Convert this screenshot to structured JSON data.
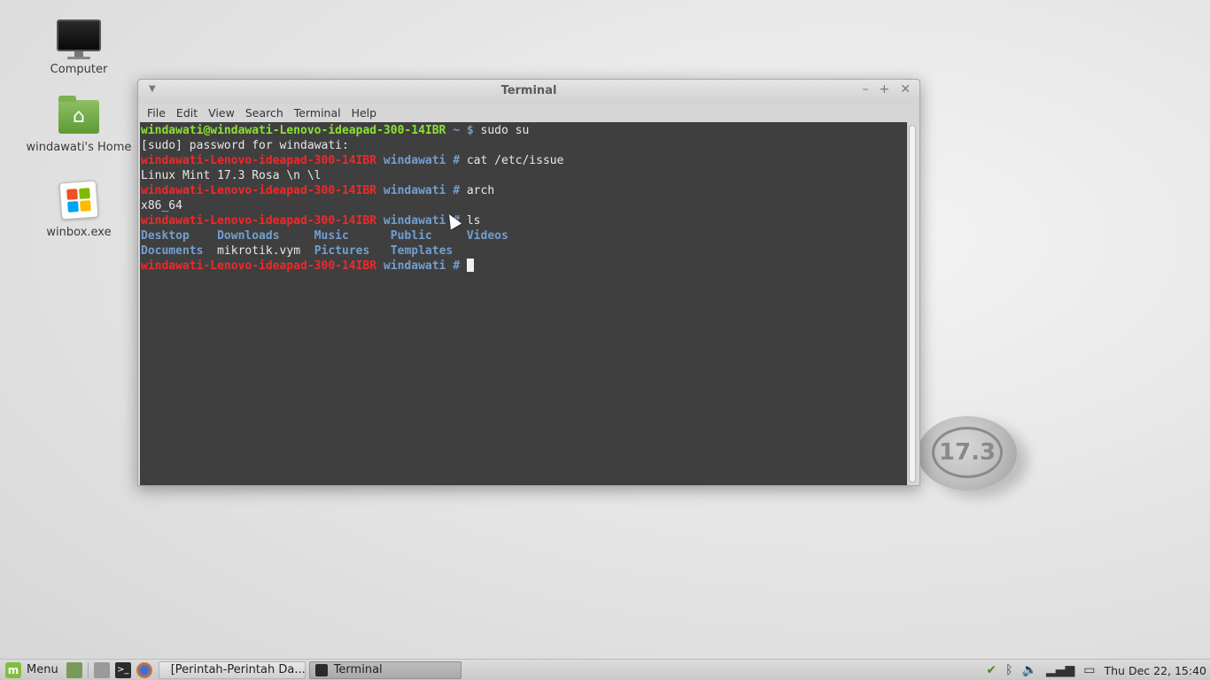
{
  "desktop": {
    "icons": [
      {
        "label": "Computer",
        "icon": "computer-icon"
      },
      {
        "label": "windawati's Home",
        "icon": "home-folder-icon"
      },
      {
        "label": "winbox.exe",
        "icon": "exe-file-icon"
      }
    ],
    "wallpaper_badge": "17.3"
  },
  "window": {
    "title": "Terminal",
    "menu": [
      "File",
      "Edit",
      "View",
      "Search",
      "Terminal",
      "Help"
    ],
    "lines": [
      [
        {
          "t": "windawati@windawati-Lenovo-ideapad-300-14IBR",
          "c": "green"
        },
        {
          "t": " ~ $ ",
          "c": "blue"
        },
        {
          "t": "sudo su",
          "c": ""
        }
      ],
      [
        {
          "t": "[sudo] password for windawati:",
          "c": ""
        }
      ],
      [
        {
          "t": "windawati-Lenovo-ideapad-300-14IBR",
          "c": "red"
        },
        {
          "t": " windawati # ",
          "c": "blue"
        },
        {
          "t": "cat /etc/issue",
          "c": ""
        }
      ],
      [
        {
          "t": "Linux Mint 17.3 Rosa \\n \\l",
          "c": ""
        }
      ],
      [
        {
          "t": "windawati-Lenovo-ideapad-300-14IBR",
          "c": "red"
        },
        {
          "t": " windawati # ",
          "c": "blue"
        },
        {
          "t": "arch",
          "c": ""
        }
      ],
      [
        {
          "t": "x86_64",
          "c": ""
        }
      ],
      [
        {
          "t": "windawati-Lenovo-ideapad-300-14IBR",
          "c": "red"
        },
        {
          "t": " windawati # ",
          "c": "blue"
        },
        {
          "t": "ls",
          "c": ""
        }
      ],
      [
        {
          "t": "Desktop    Downloads     Music      Public     Videos",
          "c": "blue"
        }
      ],
      [
        {
          "t": "Documents",
          "c": "blue"
        },
        {
          "t": "  mikrotik.vym  ",
          "c": ""
        },
        {
          "t": "Pictures",
          "c": "blue"
        },
        {
          "t": "   ",
          "c": ""
        },
        {
          "t": "Templates",
          "c": "blue"
        }
      ],
      [
        {
          "t": "windawati-Lenovo-ideapad-300-14IBR",
          "c": "red"
        },
        {
          "t": " windawati # ",
          "c": "blue"
        }
      ]
    ]
  },
  "taskbar": {
    "menu_label": "Menu",
    "tasks": [
      {
        "label": "[Perintah-Perintah Da...",
        "active": false
      },
      {
        "label": "Terminal",
        "active": true
      }
    ],
    "clock": "Thu Dec 22, 15:40"
  },
  "colors": {
    "prompt_user": "#8ae234",
    "prompt_host_root": "#ef2929",
    "prompt_path": "#729fcf",
    "terminal_bg": "#3a3a3a"
  }
}
